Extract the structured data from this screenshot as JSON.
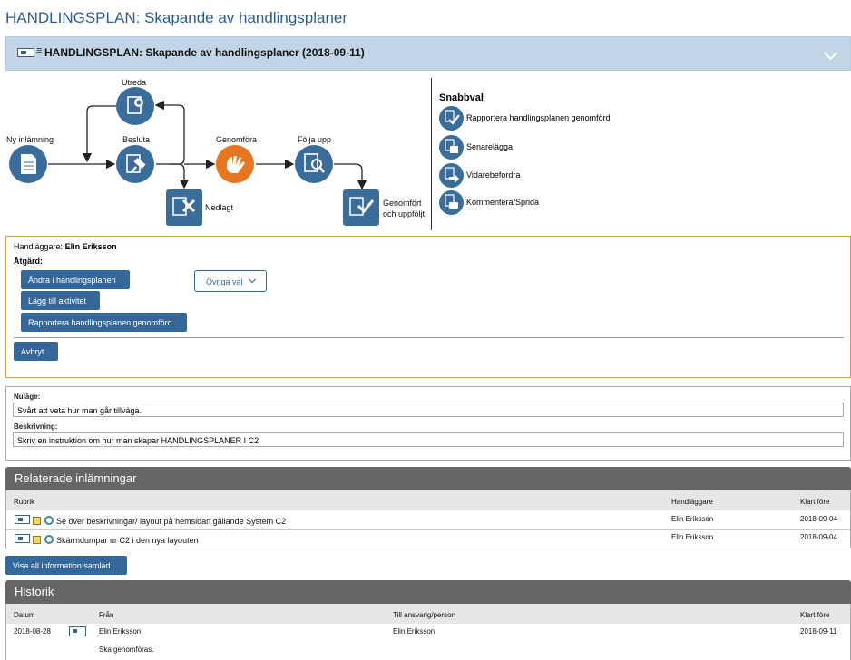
{
  "page_title": "HANDLINGSPLAN: Skapande av handlingsplaner",
  "collapse_title": "HANDLINGSPLAN: Skapande av handlingsplaner (2018-09-11)",
  "workflow": {
    "steps": {
      "ny": "Ny inlämning",
      "utreda": "Utreda",
      "besluta": "Besluta",
      "genomfora": "Genomföra",
      "folja": "Följa upp",
      "nedlagt": "Nedlagt",
      "genomfort_line1": "Genomfört",
      "genomfort_line2": "och uppföljt"
    }
  },
  "snabbval": {
    "title": "Snabbval",
    "items": [
      {
        "label": "Rapportera handlingsplanen genomförd",
        "icon": "report-done-icon"
      },
      {
        "label": "Senarelägga",
        "icon": "postpone-icon"
      },
      {
        "label": "Vidarebefordra",
        "icon": "forward-icon"
      },
      {
        "label": "Kommentera/Sprida",
        "icon": "comment-icon"
      }
    ]
  },
  "actions": {
    "handlaggare_label": "Handläggare:",
    "handlaggare_name": "Elin Eriksson",
    "atgard_label": "Åtgärd:",
    "btn_andra": "Ändra i handlingsplanen",
    "btn_lagg": "Lägg till aktivitet",
    "btn_rapportera": "Rapportera handlingsplanen genomförd",
    "ovriga": "Övriga val",
    "avbryt": "Avbryt"
  },
  "fields": {
    "nulage_label": "Nuläge:",
    "nulage_value": "Svårt att veta hur man går tillväga.",
    "beskrivning_label": "Beskrivning:",
    "beskrivning_value": "Skriv en instruktion om hur man skapar HANDLINGSPLANER I C2"
  },
  "related": {
    "title": "Relaterade inlämningar",
    "headers": {
      "rubrik": "Rubrik",
      "handlaggare": "Handläggare",
      "klart": "Klart före"
    },
    "rows": [
      {
        "rubrik": "Se över beskrivningar/ layout på hemsidan gällande System C2",
        "handlaggare": "Elin Eriksson",
        "klart": "2018-09-04"
      },
      {
        "rubrik": "Skärmdumpar ur C2 i den nya layouten",
        "handlaggare": "Elin Eriksson",
        "klart": "2018-09-04"
      }
    ],
    "btn_visa": "Visa all information samlad"
  },
  "historik": {
    "title": "Historik",
    "headers": {
      "datum": "Datum",
      "fran": "Från",
      "till": "Till ansvarig/person",
      "klart": "Klart före"
    },
    "rows": [
      {
        "datum": "2018-08-28",
        "fran": "Elin Eriksson",
        "till": "Elin Eriksson",
        "klart": "2018-09-11",
        "note": "Ska genomföras."
      }
    ]
  },
  "colors": {
    "primary": "#35689a",
    "orange": "#e6761f",
    "header_gray": "#666666",
    "accent_border": "#d4a14a"
  }
}
